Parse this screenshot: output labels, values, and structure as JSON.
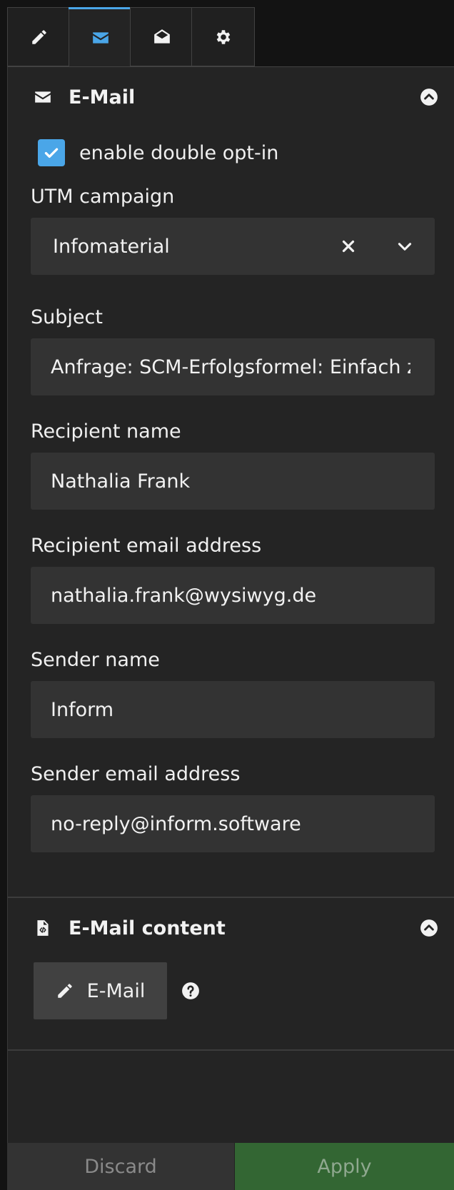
{
  "tabs": [
    {
      "icon": "pencil-icon",
      "active": false
    },
    {
      "icon": "envelope-icon",
      "active": true
    },
    {
      "icon": "envelope-open-icon",
      "active": false
    },
    {
      "icon": "gear-icon",
      "active": false
    }
  ],
  "colors": {
    "accent": "#4aa6e8",
    "apply": "#336633",
    "panel": "#242424",
    "input": "#333333"
  },
  "email_section": {
    "title": "E-Mail",
    "icon": "envelope-icon",
    "double_opt_in": {
      "label": "enable double opt-in",
      "checked": true
    },
    "utm_campaign": {
      "label": "UTM campaign",
      "value": "Infomaterial"
    },
    "subject": {
      "label": "Subject",
      "value": "Anfrage: SCM-Erfolgsformel: Einfach zu"
    },
    "recipient_name": {
      "label": "Recipient name",
      "value": "Nathalia Frank"
    },
    "recipient_email": {
      "label": "Recipient email address",
      "value": "nathalia.frank@wysiwyg.de"
    },
    "sender_name": {
      "label": "Sender name",
      "value": "Inform"
    },
    "sender_email": {
      "label": "Sender email address",
      "value": "no-reply@inform.software"
    }
  },
  "content_section": {
    "title": "E-Mail content",
    "icon": "file-code-icon",
    "edit_button_label": "E-Mail"
  },
  "footer": {
    "discard_label": "Discard",
    "apply_label": "Apply"
  }
}
